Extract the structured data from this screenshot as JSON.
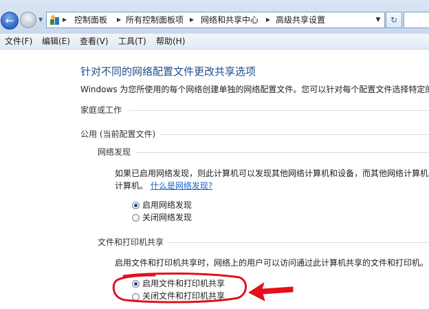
{
  "address_bar": {
    "crumbs": [
      "控制面板",
      "所有控制面板项",
      "网络和共享中心",
      "高级共享设置"
    ]
  },
  "menu": [
    "文件(F)",
    "编辑(E)",
    "查看(V)",
    "工具(T)",
    "帮助(H)"
  ],
  "content": {
    "title": "针对不同的网络配置文件更改共享选项",
    "intro": "Windows 为您所使用的每个网络创建单独的网络配置文件。您可以针对每个配置文件选择特定的",
    "profile_home": "家庭或工作",
    "profile_public": "公用 (当前配置文件)",
    "network_discovery": {
      "heading": "网络发现",
      "desc_line1": "如果已启用网络发现，则此计算机可以发现其他网络计算机和设备，而其他网络计算机",
      "desc_line2": "计算机。",
      "link": "什么是网络发现?",
      "options": [
        "启用网络发现",
        "关闭网络发现"
      ],
      "selected": 0
    },
    "file_printer_sharing": {
      "heading": "文件和打印机共享",
      "desc": "启用文件和打印机共享时，网络上的用户可以访问通过此计算机共享的文件和打印机。",
      "options": [
        "启用文件和打印机共享",
        "关闭文件和打印机共享"
      ],
      "selected": 0
    }
  },
  "colors": {
    "title": "#1f4e8c",
    "link": "#1a61c7",
    "annotation": "#e3101b"
  }
}
